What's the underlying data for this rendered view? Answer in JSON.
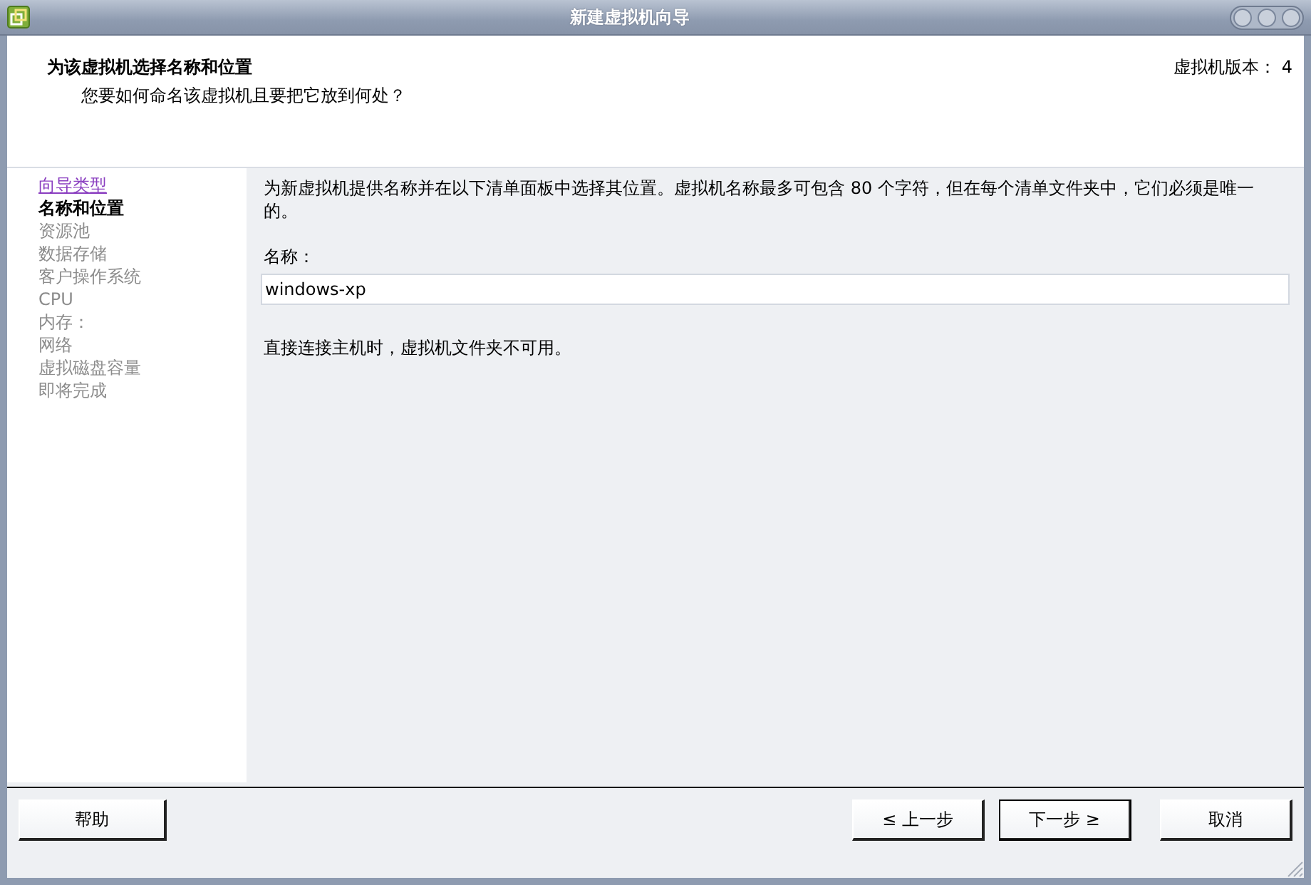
{
  "window": {
    "title": "新建虚拟机向导"
  },
  "header": {
    "title": "为该虚拟机选择名称和位置",
    "subtitle": "您要如何命名该虚拟机且要把它放到何处？",
    "version": "虚拟机版本： 4"
  },
  "steps": [
    {
      "label": "向导类型",
      "selected": false,
      "disabled": false
    },
    {
      "label": "名称和位置",
      "selected": true,
      "disabled": false
    },
    {
      "label": "资源池",
      "selected": false,
      "disabled": true
    },
    {
      "label": "数据存储",
      "selected": false,
      "disabled": true
    },
    {
      "label": "客户操作系统",
      "selected": false,
      "disabled": true
    },
    {
      "label": "CPU",
      "selected": false,
      "disabled": true
    },
    {
      "label": "内存：",
      "selected": false,
      "disabled": true
    },
    {
      "label": "网络",
      "selected": false,
      "disabled": true
    },
    {
      "label": "虚拟磁盘容量",
      "selected": false,
      "disabled": true
    },
    {
      "label": "即将完成",
      "selected": false,
      "disabled": true
    }
  ],
  "content": {
    "description": "为新虚拟机提供名称并在以下清单面板中选择其位置。虚拟机名称最多可包含 80 个字符，但在每个清单文件夹中，它们必须是唯一的。",
    "name_label": "名称：",
    "name_value": "windows-xp",
    "note": "直接连接主机时，虚拟机文件夹不可用。"
  },
  "buttons": [
    {
      "label": "帮助",
      "kind": "help",
      "default": false
    },
    {
      "label": "≤ 上一步",
      "kind": "nav",
      "default": false
    },
    {
      "label": "下一步 ≥",
      "kind": "nav",
      "default": true
    },
    {
      "label": "取消",
      "kind": "cancel",
      "default": false
    }
  ]
}
